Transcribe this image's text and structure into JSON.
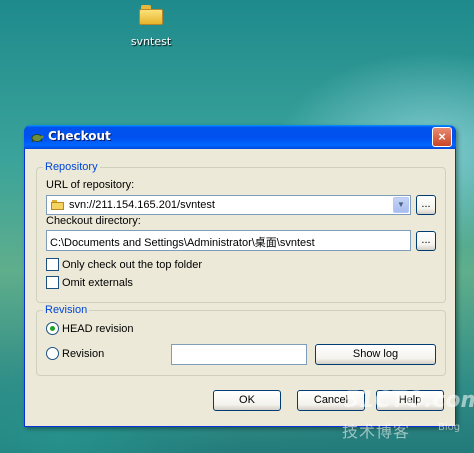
{
  "desktop": {
    "icon_label": "svntest"
  },
  "dialog": {
    "title": "Checkout",
    "close_glyph": "×",
    "repository": {
      "group_label": "Repository",
      "url_label": "URL of repository:",
      "url_value": "svn://211.154.165.201/svntest",
      "checkout_dir_label": "Checkout directory:",
      "checkout_dir_value": "C:\\Documents and Settings\\Administrator\\桌面\\svntest",
      "browse_label": "...",
      "only_top_folder_label": "Only check out the top folder",
      "only_top_folder_checked": false,
      "omit_externals_label": "Omit externals",
      "omit_externals_checked": false
    },
    "revision": {
      "group_label": "Revision",
      "head_label": "HEAD revision",
      "head_selected": true,
      "revision_label": "Revision",
      "revision_selected": false,
      "revision_value": "",
      "show_log_label": "Show log"
    },
    "buttons": {
      "ok": "OK",
      "cancel": "Cancel",
      "help": "Help"
    }
  },
  "watermark": {
    "line1": "51CTO.com",
    "line2": "技术博客",
    "line3": "Blog"
  },
  "colors": {
    "titlebar": "#0050ee",
    "group_title": "#0046d5",
    "dialog_bg": "#ece9d8"
  }
}
